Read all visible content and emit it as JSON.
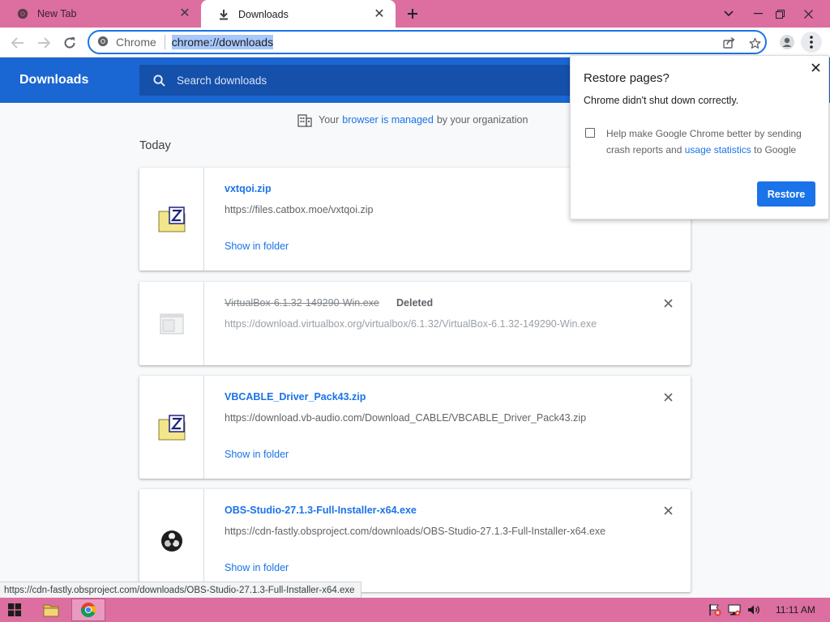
{
  "tabs": [
    {
      "title": "New Tab",
      "active": false
    },
    {
      "title": "Downloads",
      "active": true
    }
  ],
  "omnibox": {
    "site_chip": "Chrome",
    "url": "chrome://downloads"
  },
  "downloads": {
    "title": "Downloads",
    "search_placeholder": "Search downloads",
    "managed": {
      "prefix": "Your",
      "link": "browser is managed",
      "suffix": "by your organization"
    },
    "section_today": "Today",
    "items": [
      {
        "filename": "vxtqoi.zip",
        "url": "https://files.catbox.moe/vxtqoi.zip",
        "action": "Show in folder",
        "icon": "zip-file-icon"
      },
      {
        "filename": "VirtualBox-6.1.32-149290-Win.exe",
        "status": "Deleted",
        "url": "https://download.virtualbox.org/virtualbox/6.1.32/VirtualBox-6.1.32-149290-Win.exe",
        "icon": "exe-file-icon"
      },
      {
        "filename": "VBCABLE_Driver_Pack43.zip",
        "url": "https://download.vb-audio.com/Download_CABLE/VBCABLE_Driver_Pack43.zip",
        "action": "Show in folder",
        "icon": "zip-file-icon"
      },
      {
        "filename": "OBS-Studio-27.1.3-Full-Installer-x64.exe",
        "url": "https://cdn-fastly.obsproject.com/downloads/OBS-Studio-27.1.3-Full-Installer-x64.exe",
        "action": "Show in folder",
        "icon": "obs-icon"
      }
    ]
  },
  "restore_popup": {
    "title": "Restore pages?",
    "subtitle": "Chrome didn't shut down correctly.",
    "checkbox_text_1": "Help make Google Chrome better by sending crash reports and",
    "checkbox_link": "usage statistics",
    "checkbox_text_2": "to Google",
    "button": "Restore"
  },
  "status_bubble": "https://cdn-fastly.obsproject.com/downloads/OBS-Studio-27.1.3-Full-Installer-x64.exe",
  "taskbar": {
    "clock": "11:11 AM"
  },
  "colors": {
    "accent": "#1a73e8",
    "header": "#1a66d2",
    "tabstrip": "#dc6ea0"
  }
}
